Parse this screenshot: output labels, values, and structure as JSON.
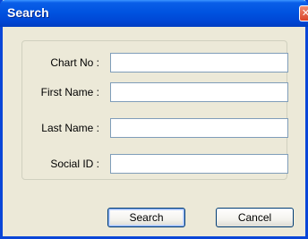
{
  "window": {
    "title": "Search"
  },
  "form": {
    "fields": [
      {
        "label": "Chart No :",
        "value": "",
        "placeholder": ""
      },
      {
        "label": "First Name :",
        "value": "",
        "placeholder": ""
      },
      {
        "label": "Last Name :",
        "value": "",
        "placeholder": ""
      },
      {
        "label": "Social ID :",
        "value": "",
        "placeholder": ""
      }
    ]
  },
  "buttons": {
    "search_label": "Search",
    "cancel_label": "Cancel"
  },
  "icons": {
    "close": "close-icon"
  },
  "colors": {
    "titlebar": "#0053e0",
    "window_bg": "#ece9d8",
    "close_button": "#d9442a",
    "input_border": "#7f9db9"
  }
}
